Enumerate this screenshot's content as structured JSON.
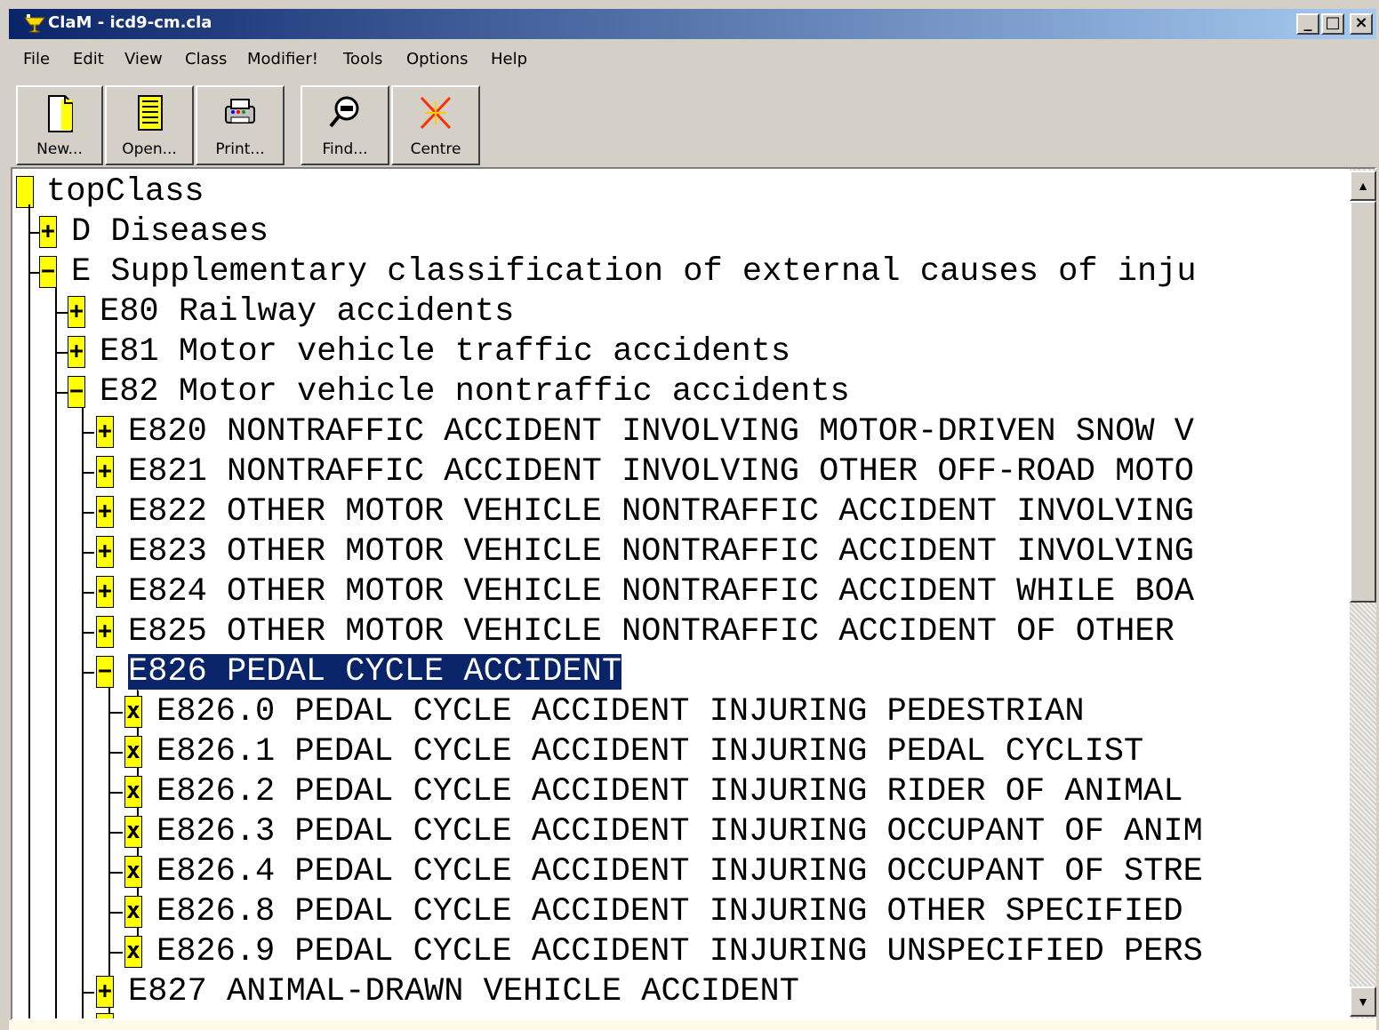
{
  "window": {
    "title": "ClaM - icd9-cm.cla",
    "controls": [
      "_",
      "□",
      "×"
    ]
  },
  "menu": [
    {
      "label": "File"
    },
    {
      "label": "Edit"
    },
    {
      "label": "View"
    },
    {
      "label": "Class"
    },
    {
      "label": "Modifier!"
    },
    {
      "label": "Tools"
    },
    {
      "label": "Options"
    },
    {
      "label": "Help"
    }
  ],
  "toolbar": {
    "new": "New...",
    "open": "Open...",
    "print": "Print...",
    "find": "Find...",
    "centre": "Centre"
  },
  "tree": {
    "root": "topClass",
    "rows": [
      {
        "marker": "+",
        "text": "D Diseases"
      },
      {
        "marker": "−",
        "text": "E Supplementary classification of external causes of inju"
      },
      {
        "marker": "+",
        "text": "E80 Railway accidents"
      },
      {
        "marker": "+",
        "text": "E81 Motor vehicle traffic accidents"
      },
      {
        "marker": "−",
        "text": "E82 Motor vehicle nontraffic accidents"
      },
      {
        "marker": "+",
        "text": "E820 NONTRAFFIC ACCIDENT INVOLVING MOTOR-DRIVEN SNOW V"
      },
      {
        "marker": "+",
        "text": "E821 NONTRAFFIC ACCIDENT INVOLVING OTHER OFF-ROAD MOTO"
      },
      {
        "marker": "+",
        "text": "E822 OTHER MOTOR VEHICLE NONTRAFFIC ACCIDENT INVOLVING"
      },
      {
        "marker": "+",
        "text": "E823 OTHER MOTOR VEHICLE NONTRAFFIC ACCIDENT INVOLVING"
      },
      {
        "marker": "+",
        "text": "E824 OTHER MOTOR VEHICLE NONTRAFFIC ACCIDENT WHILE BOA"
      },
      {
        "marker": "+",
        "text": "E825 OTHER MOTOR VEHICLE NONTRAFFIC ACCIDENT OF OTHER"
      },
      {
        "marker": "−",
        "text": "E826 PEDAL CYCLE ACCIDENT"
      },
      {
        "marker": "x",
        "text": "E826.0 PEDAL CYCLE ACCIDENT INJURING PEDESTRIAN"
      },
      {
        "marker": "x",
        "text": "E826.1 PEDAL CYCLE ACCIDENT INJURING PEDAL CYCLIST"
      },
      {
        "marker": "x",
        "text": "E826.2 PEDAL CYCLE ACCIDENT INJURING RIDER OF ANIMAL"
      },
      {
        "marker": "x",
        "text": "E826.3 PEDAL CYCLE ACCIDENT INJURING OCCUPANT OF ANIM"
      },
      {
        "marker": "x",
        "text": "E826.4 PEDAL CYCLE ACCIDENT INJURING OCCUPANT OF STRE"
      },
      {
        "marker": "x",
        "text": "E826.8 PEDAL CYCLE ACCIDENT INJURING OTHER SPECIFIED"
      },
      {
        "marker": "x",
        "text": "E826.9 PEDAL CYCLE ACCIDENT INJURING UNSPECIFIED PERS"
      },
      {
        "marker": "+",
        "text": "E827 ANIMAL-DRAWN VEHICLE ACCIDENT"
      }
    ]
  },
  "scrollbar": {
    "up": "▲",
    "down": "▼"
  }
}
